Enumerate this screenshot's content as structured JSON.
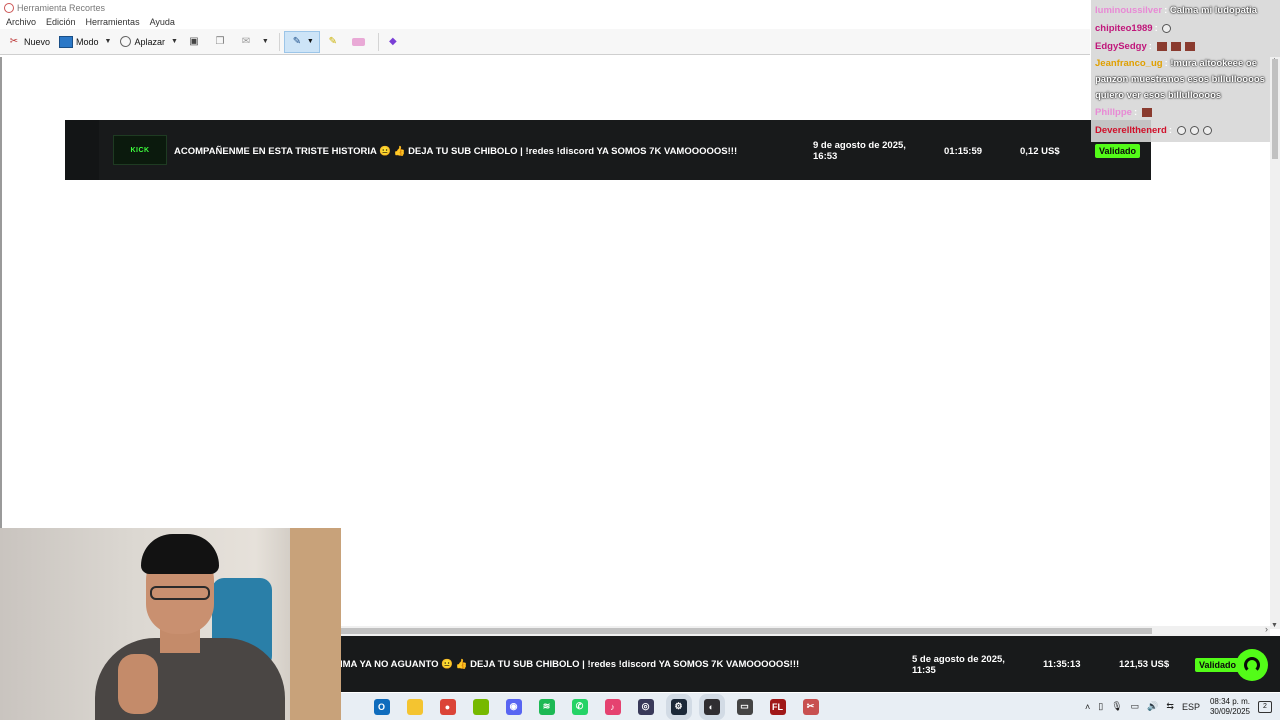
{
  "window": {
    "title": "Herramienta Recortes",
    "menu": [
      "Archivo",
      "Edición",
      "Herramientas",
      "Ayuda"
    ]
  },
  "toolbar": {
    "new_label": "Nuevo",
    "mode_label": "Modo",
    "delay_label": "Aplazar"
  },
  "capture": {
    "logo_text": "KICK",
    "title": "ACOMPAÑENME EN ESTA TRISTE HISTORIA 😐 👍 DEJA TU SUB CHIBOLO | !redes !discord YA SOMOS 7K VAMOOOOOS!!!",
    "date": "9 de agosto de 2025, 16:53",
    "duration": "01:15:59",
    "amount": "0,12 US$",
    "status": "Validado"
  },
  "chat": [
    {
      "user": "luminoussilver",
      "sep": ":",
      "msg": "Calma mi ludopatia",
      "color": "#e88ad5"
    },
    {
      "user": "chipiteo1989",
      "sep": ":",
      "msg": "",
      "color": "#c0167a",
      "emotes": [
        "white"
      ]
    },
    {
      "user": "EdgySedgy",
      "sep": ":",
      "msg": "",
      "color": "#c0167a",
      "emotes": [
        "red",
        "red",
        "red"
      ]
    },
    {
      "user": "Jeanfranco_ug",
      "sep": ":",
      "msg": "!mura altookeee oe panzon muestranos esos billulloooos quiero ver esos billulloooos",
      "color": "#e0a000",
      "wrap": true
    },
    {
      "user": "Phillppe",
      "sep": ":",
      "msg": "",
      "color": "#e88ad5",
      "emotes": [
        "red"
      ]
    },
    {
      "user": "Deverellthenerd",
      "sep": ":",
      "msg": "",
      "color": "#d0102a",
      "emotes": [
        "white",
        "white",
        "white"
      ]
    }
  ],
  "bottom_row": {
    "title": "IMA YA NO AGUANTO 😐 👍 DEJA TU SUB CHIBOLO | !redes !discord YA SOMOS 7K VAMOOOOOS!!!",
    "date": "5 de agosto de 2025, 11:35",
    "duration": "11:35:13",
    "amount": "121,53 US$",
    "status": "Validado"
  },
  "taskbar": {
    "apps": [
      {
        "name": "outlook-icon",
        "color": "#0f6cbd",
        "glyph": "O"
      },
      {
        "name": "file-explorer-icon",
        "color": "#f4c430",
        "glyph": ""
      },
      {
        "name": "chrome-icon",
        "color": "#db4437",
        "glyph": "●"
      },
      {
        "name": "nvidia-icon",
        "color": "#76b900",
        "glyph": ""
      },
      {
        "name": "discord-icon",
        "color": "#5865f2",
        "glyph": "◉"
      },
      {
        "name": "spotify-icon",
        "color": "#1db954",
        "glyph": "≋"
      },
      {
        "name": "whatsapp-icon",
        "color": "#25d366",
        "glyph": "✆"
      },
      {
        "name": "itunes-icon",
        "color": "#e54270",
        "glyph": "♪"
      },
      {
        "name": "app-icon",
        "color": "#3a3a5a",
        "glyph": "◎"
      },
      {
        "name": "steam-icon",
        "color": "#1b2838",
        "glyph": "⚙"
      },
      {
        "name": "obs-icon",
        "color": "#302e31",
        "glyph": "◐"
      },
      {
        "name": "app-dark-icon",
        "color": "#444",
        "glyph": "▭"
      },
      {
        "name": "fl-studio-icon",
        "color": "#a01818",
        "glyph": "FL"
      },
      {
        "name": "snipping-tool-icon",
        "color": "#c85050",
        "glyph": "✂"
      }
    ],
    "language": "ESP",
    "time": "08:34 p. m.",
    "date": "30/09/2025",
    "notifications": "2"
  }
}
